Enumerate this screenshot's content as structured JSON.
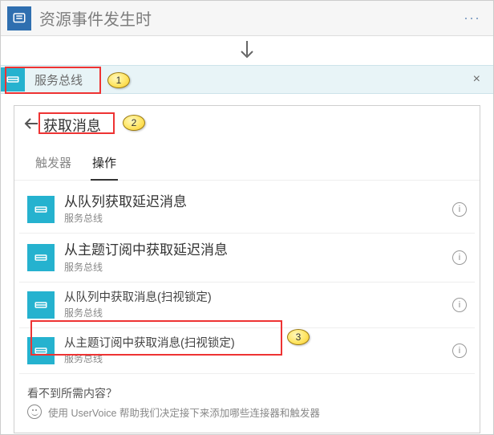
{
  "header": {
    "title": "资源事件发生时",
    "menu_label": "···"
  },
  "servicebus_bar": {
    "label": "服务总线",
    "close": "×"
  },
  "search": {
    "placeholder": "",
    "value": "获取消息"
  },
  "tabs": {
    "triggers": "触发器",
    "actions": "操作"
  },
  "actions": [
    {
      "title": "从队列获取延迟消息",
      "sub": "服务总线",
      "big": true
    },
    {
      "title": "从主题订阅中获取延迟消息",
      "sub": "服务总线",
      "big": true
    },
    {
      "title": "从队列中获取消息(扫视锁定)",
      "sub": "服务总线",
      "big": false
    },
    {
      "title": "从主题订阅中获取消息(扫视锁定)",
      "sub": "服务总线",
      "big": false
    }
  ],
  "footer": {
    "question": "看不到所需内容？",
    "suggest": "使用 UserVoice 帮助我们决定接下来添加哪些连接器和触发器"
  },
  "badges": {
    "b1": "1",
    "b2": "2",
    "b3": "3"
  },
  "icons": {
    "app": "app-icon",
    "servicebus": "servicebus-icon",
    "info": "i"
  }
}
